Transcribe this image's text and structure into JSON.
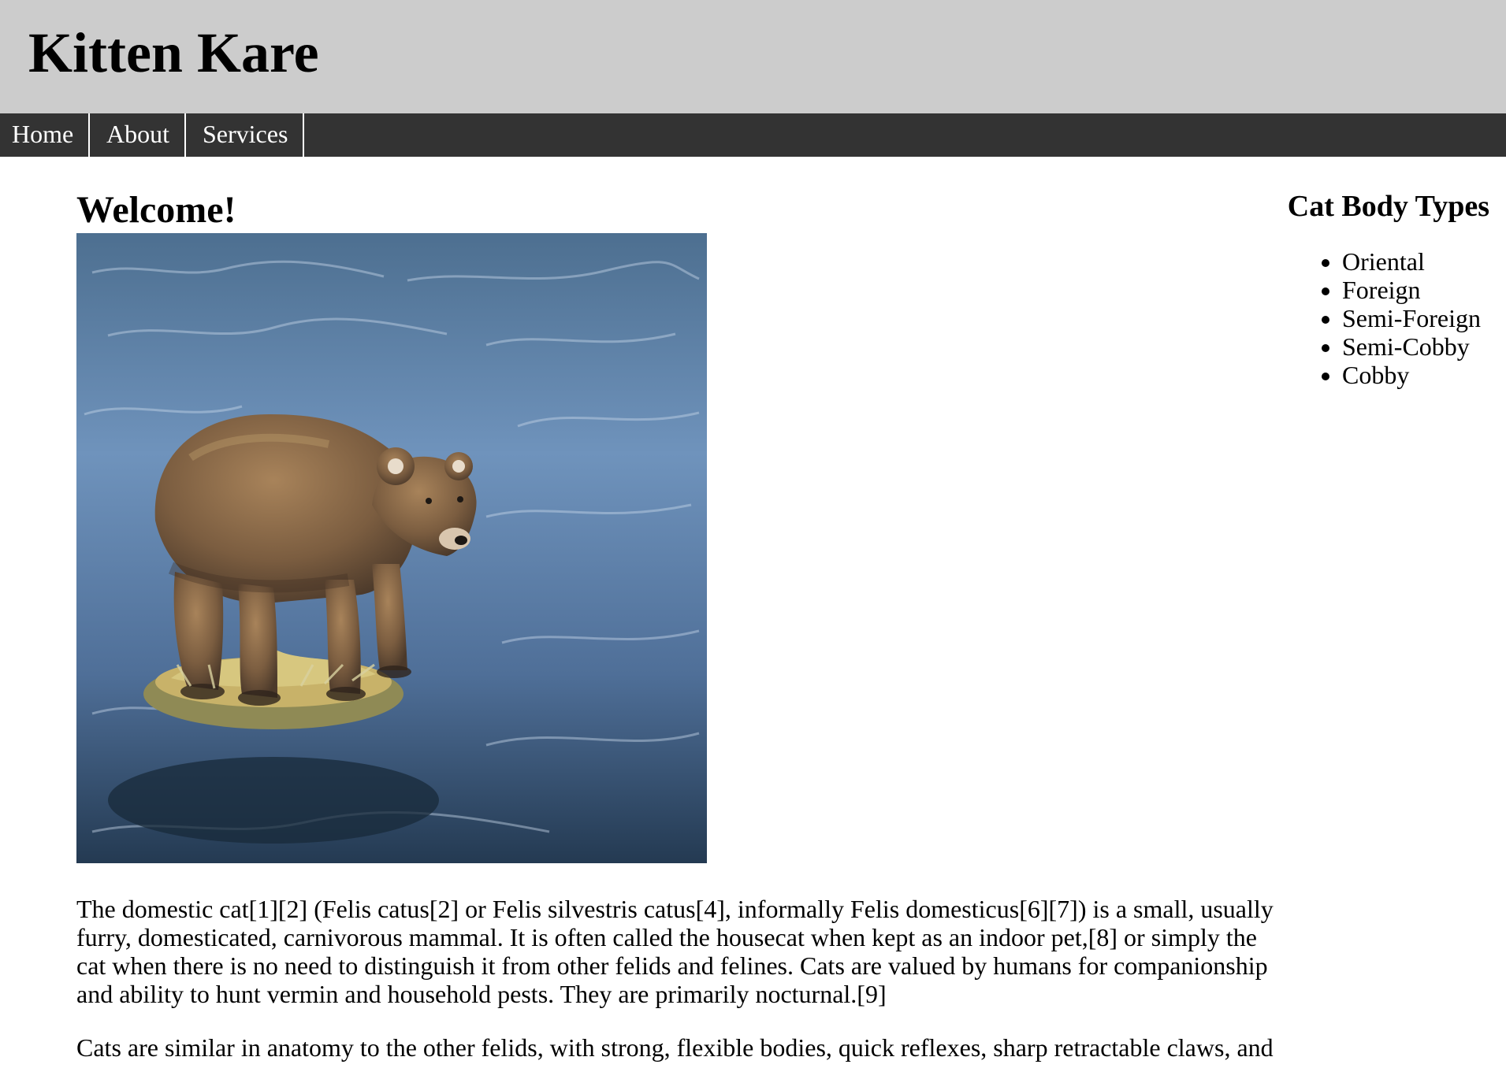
{
  "header": {
    "title": "Kitten Kare"
  },
  "nav": {
    "items": [
      {
        "label": "Home"
      },
      {
        "label": "About"
      },
      {
        "label": "Services"
      }
    ]
  },
  "main": {
    "heading": "Welcome!",
    "image_icon": "bear-standing-in-river-photo",
    "paragraphs": [
      "The domestic cat[1][2] (Felis catus[2] or Felis silvestris catus[4], informally Felis domesticus[6][7]) is a small, usually furry, domesticated, carnivorous mammal. It is often called the housecat when kept as an indoor pet,[8] or simply the cat when there is no need to distinguish it from other felids and felines. Cats are valued by humans for companionship and ability to hunt vermin and household pests. They are primarily nocturnal.[9]",
      "Cats are similar in anatomy to the other felids, with strong, flexible bodies, quick reflexes, sharp retractable claws, and"
    ]
  },
  "sidebar": {
    "title": "Cat Body Types",
    "items": [
      "Oriental",
      "Foreign",
      "Semi-Foreign",
      "Semi-Cobby",
      "Cobby"
    ]
  },
  "colors": {
    "header_bg": "#cccccc",
    "nav_bg": "#333333",
    "nav_text": "#ffffff",
    "page_bg": "#ffffff",
    "text": "#000000"
  }
}
